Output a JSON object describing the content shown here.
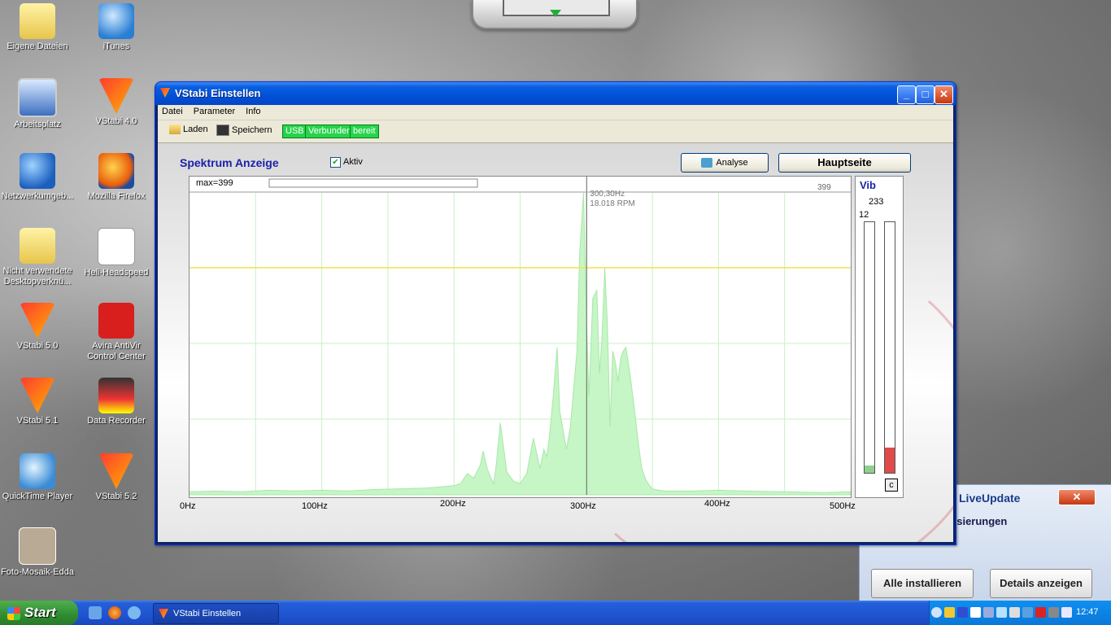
{
  "desktop": {
    "icons_col1": [
      {
        "label": "Eigene Dateien",
        "icon": "folder-icon"
      },
      {
        "label": "Arbeitsplatz",
        "icon": "computer-icon"
      },
      {
        "label": "Netzwerkumgeb...",
        "icon": "network-icon"
      },
      {
        "label": "Nicht verwendete Desktopverknü...",
        "icon": "folder-icon"
      },
      {
        "label": "VStabi 5.0",
        "icon": "vstabi-icon"
      },
      {
        "label": "VStabi 5.1",
        "icon": "vstabi-icon"
      },
      {
        "label": "QuickTime Player",
        "icon": "quicktime-icon"
      },
      {
        "label": "Foto-Mosaik-Edda",
        "icon": "mosaic-icon"
      }
    ],
    "icons_col2": [
      {
        "label": "iTunes",
        "icon": "itunes-icon"
      },
      {
        "label": "VStabi 4.0",
        "icon": "vstabi-icon"
      },
      {
        "label": "Mozilla Firefox",
        "icon": "firefox-icon"
      },
      {
        "label": "Heli-Headspeed",
        "icon": "heli-icon"
      },
      {
        "label": "Avira AntiVir Control Center",
        "icon": "avira-icon"
      },
      {
        "label": "Data Recorder",
        "icon": "recorder-icon"
      },
      {
        "label": "VStabi 5.2",
        "icon": "vstabi-icon"
      }
    ],
    "badges": {
      "vstabi40": "4.0",
      "vstabi50": "5.0",
      "vstabi51": "5.1",
      "vstabi52": "5.2"
    }
  },
  "window": {
    "title": "VStabi Einstellen",
    "menu": [
      "Datei",
      "Parameter",
      "Info"
    ],
    "toolbar": {
      "load": "Laden",
      "save": "Speichern",
      "usb": "USB",
      "connected": "Verbunden",
      "ready": "bereit"
    },
    "heading": "Spektrum Anzeige",
    "active_label": "Aktiv",
    "active_checked": true,
    "analyse_button": "Analyse",
    "main_button": "Hauptseite",
    "vib": {
      "title": "Vib",
      "value_top": "233",
      "value_left": "12",
      "left_level": 0.03,
      "right_level": 0.1,
      "reset": "c"
    }
  },
  "chart_data": {
    "type": "area",
    "max_label": "max=399",
    "max_value_label": "399",
    "cursor_label_freq": "300,30Hz",
    "cursor_label_rpm": "18.018 RPM",
    "cursor_x": 300.3,
    "threshold_y": 300,
    "xlim": [
      0,
      500
    ],
    "ylim": [
      0,
      399
    ],
    "x_ticks": [
      "0Hz",
      "100Hz",
      "200Hz",
      "300Hz",
      "400Hz",
      "500Hz"
    ],
    "colors": {
      "fill": "#c6f5c6",
      "grid": "#c8f0c8",
      "threshold": "#f2e34a",
      "cursor": "#666666"
    },
    "x": [
      0,
      20,
      40,
      60,
      80,
      100,
      120,
      140,
      160,
      180,
      200,
      205,
      210,
      215,
      220,
      222,
      225,
      228,
      230,
      232,
      235,
      240,
      245,
      250,
      255,
      260,
      265,
      268,
      270,
      272,
      275,
      278,
      280,
      285,
      288,
      290,
      293,
      295,
      298,
      300,
      302,
      305,
      308,
      310,
      312,
      314,
      316,
      318,
      320,
      322,
      324,
      326,
      328,
      330,
      333,
      336,
      340,
      342,
      345,
      348,
      350,
      355,
      360,
      370,
      380,
      400,
      420,
      450,
      480,
      500
    ],
    "y": [
      4,
      5,
      4,
      6,
      5,
      6,
      5,
      7,
      8,
      9,
      12,
      15,
      28,
      22,
      40,
      58,
      35,
      22,
      15,
      40,
      95,
      30,
      18,
      15,
      28,
      75,
      35,
      60,
      50,
      75,
      130,
      195,
      110,
      60,
      90,
      130,
      190,
      320,
      399,
      240,
      130,
      260,
      270,
      160,
      210,
      300,
      225,
      90,
      190,
      175,
      150,
      180,
      190,
      195,
      160,
      120,
      60,
      35,
      20,
      12,
      8,
      6,
      5,
      5,
      5,
      6,
      5,
      4,
      3,
      4
    ]
  },
  "liveupdate": {
    "title": "LiveUpdate",
    "subtitle": "lisierungen",
    "install_button": "Alle installieren",
    "details_button": "Details anzeigen"
  },
  "taskbar": {
    "start": "Start",
    "task": "VStabi Einstellen",
    "clock": "12:47"
  }
}
